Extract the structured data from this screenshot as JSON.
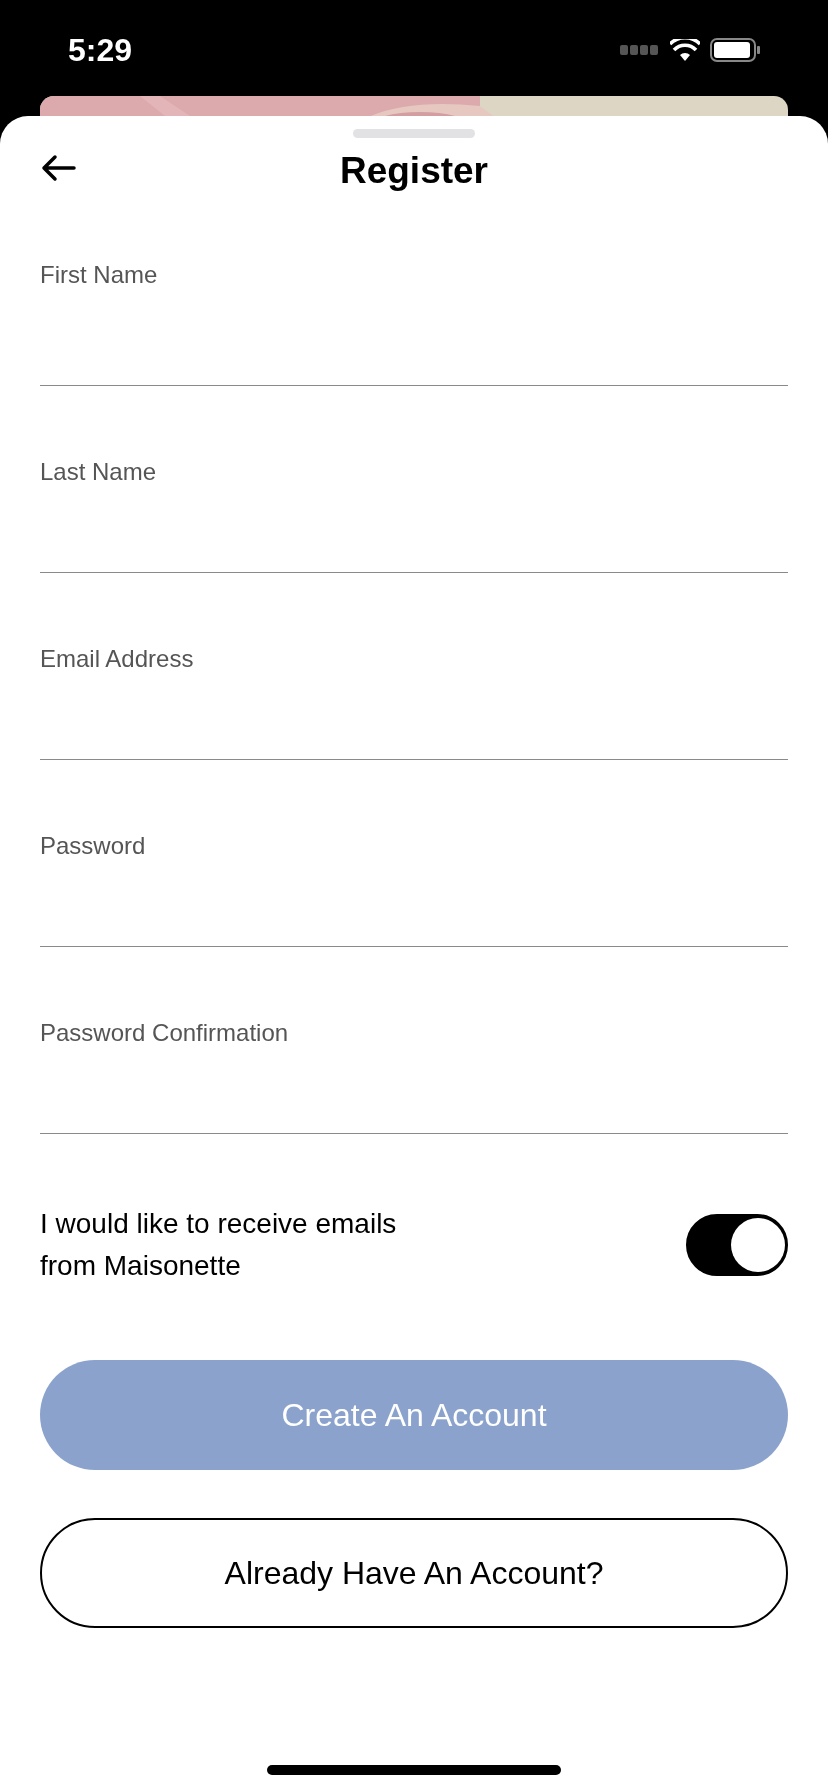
{
  "status_bar": {
    "time": "5:29"
  },
  "header": {
    "title": "Register"
  },
  "fields": [
    {
      "label": "First Name"
    },
    {
      "label": "Last Name"
    },
    {
      "label": "Email Address"
    },
    {
      "label": "Password"
    },
    {
      "label": "Password Confirmation"
    }
  ],
  "newsletter": {
    "label": "I would like to receive emails from Maisonette",
    "on": true
  },
  "buttons": [
    {
      "kind": "primary",
      "label": "Create An Account",
      "disabled": true
    },
    {
      "kind": "outline",
      "label": "Already Have An Account?",
      "disabled": false
    }
  ]
}
